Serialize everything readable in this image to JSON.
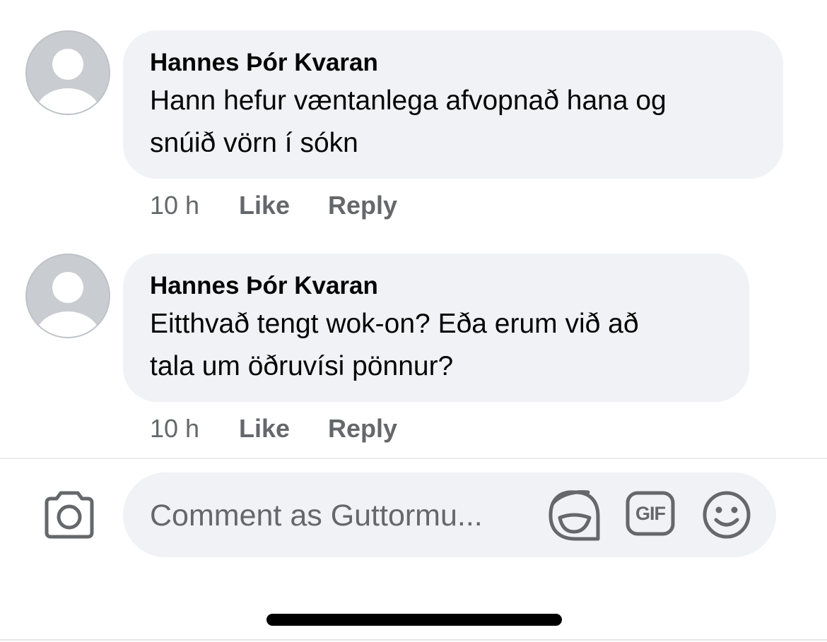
{
  "comments": [
    {
      "author": "Hannes Þór Kvaran",
      "text_line1": "Hann hefur væntanlega afvopnað hana og",
      "text_line2": "snúið vörn í sókn",
      "time": "10 h",
      "like_label": "Like",
      "reply_label": "Reply"
    },
    {
      "author": "Hannes Þór Kvaran",
      "text_line1": "Eitthvað tengt wok-on? Eða erum við að",
      "text_line2": "tala um öðruvísi pönnur?",
      "time": "10 h",
      "like_label": "Like",
      "reply_label": "Reply"
    }
  ],
  "composer": {
    "placeholder": "Comment as Guttormu...",
    "icons": [
      "camera-icon",
      "sticker-icon",
      "gif-icon",
      "emoji-icon"
    ],
    "gif_label": "GIF"
  },
  "colors": {
    "bubble": "#f0f2f5",
    "avatar": "#c9ccd1",
    "secondary_text": "#65676b",
    "icon": "#65676b"
  }
}
